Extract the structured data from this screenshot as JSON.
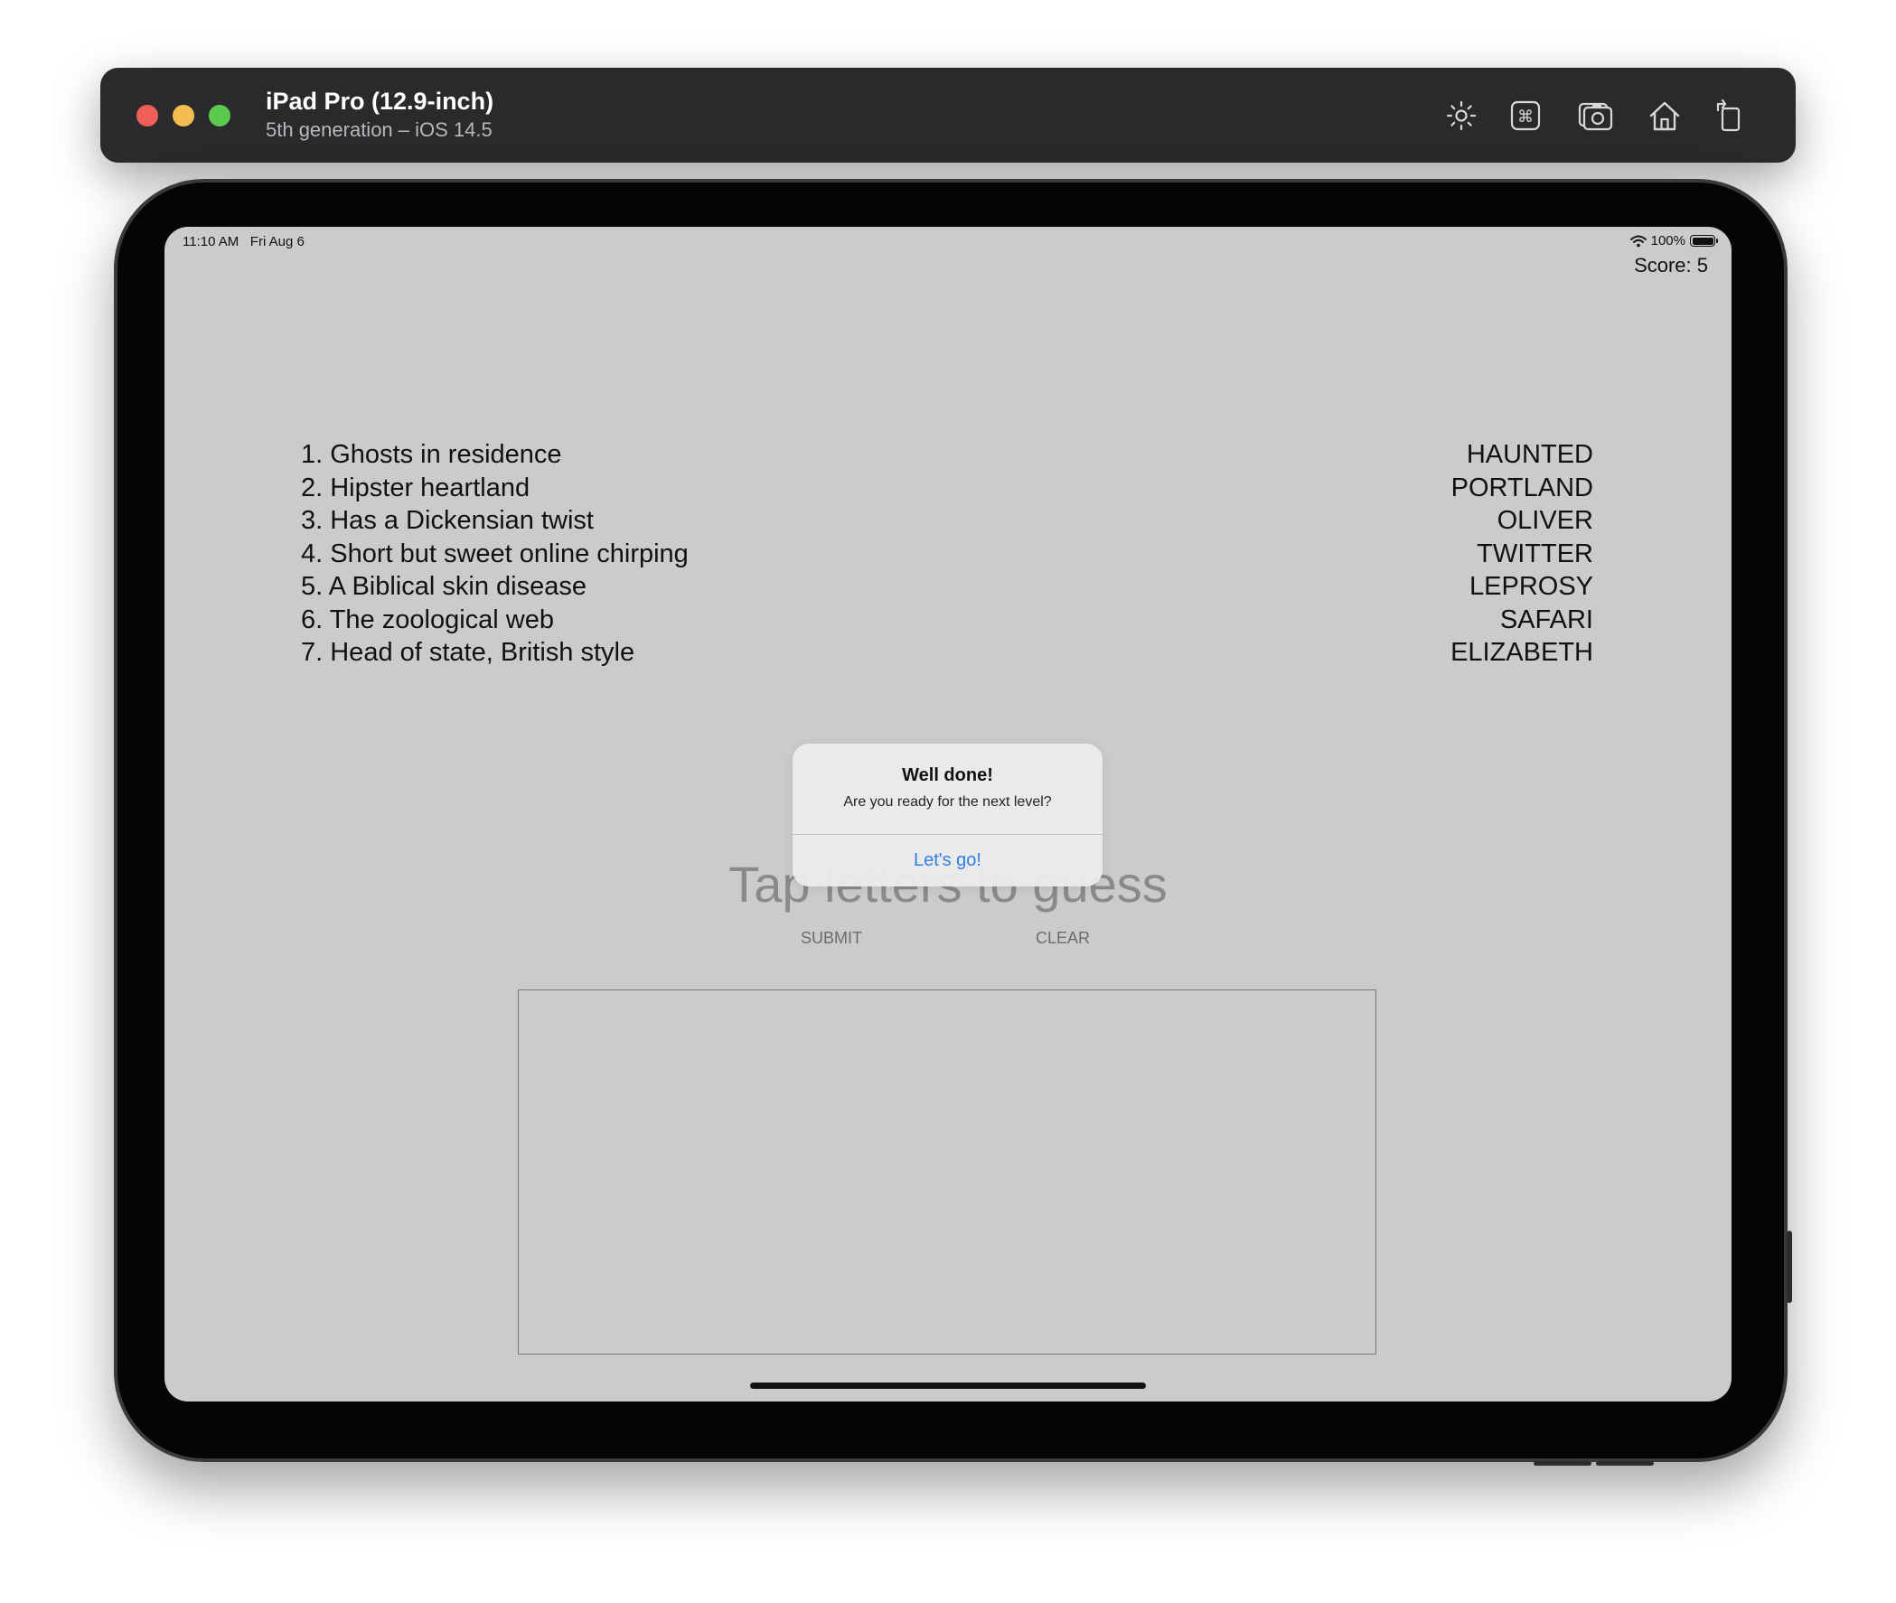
{
  "window": {
    "title": "iPad Pro (12.9-inch)",
    "subtitle": "5th generation – iOS 14.5",
    "toolbar_icons": [
      "brightness-icon",
      "command-key-icon",
      "screenshot-icon",
      "home-icon",
      "rotate-icon"
    ]
  },
  "status_bar": {
    "time": "11:10 AM",
    "date": "Fri Aug 6",
    "battery_percent": "100%"
  },
  "game": {
    "score": "Score: 5",
    "clues": [
      "1. Ghosts in residence",
      "2. Hipster heartland",
      "3. Has a Dickensian twist",
      "4. Short but sweet online chirping",
      "5. A Biblical skin disease",
      "6. The zoological web",
      "7. Head of state, British style"
    ],
    "answers": [
      "HAUNTED",
      "PORTLAND",
      "OLIVER",
      "TWITTER",
      "LEPROSY",
      "SAFARI",
      "ELIZABETH"
    ],
    "current_answer_placeholder": "Tap letters to guess",
    "submit_label": "SUBMIT",
    "clear_label": "CLEAR"
  },
  "alert": {
    "title": "Well done!",
    "message": "Are you ready for the next level?",
    "action_label": "Let's go!"
  },
  "colors": {
    "screen_background": "#cbcbcb",
    "alert_action": "#2f7ee6",
    "titlebar": "#2a2a2c"
  }
}
